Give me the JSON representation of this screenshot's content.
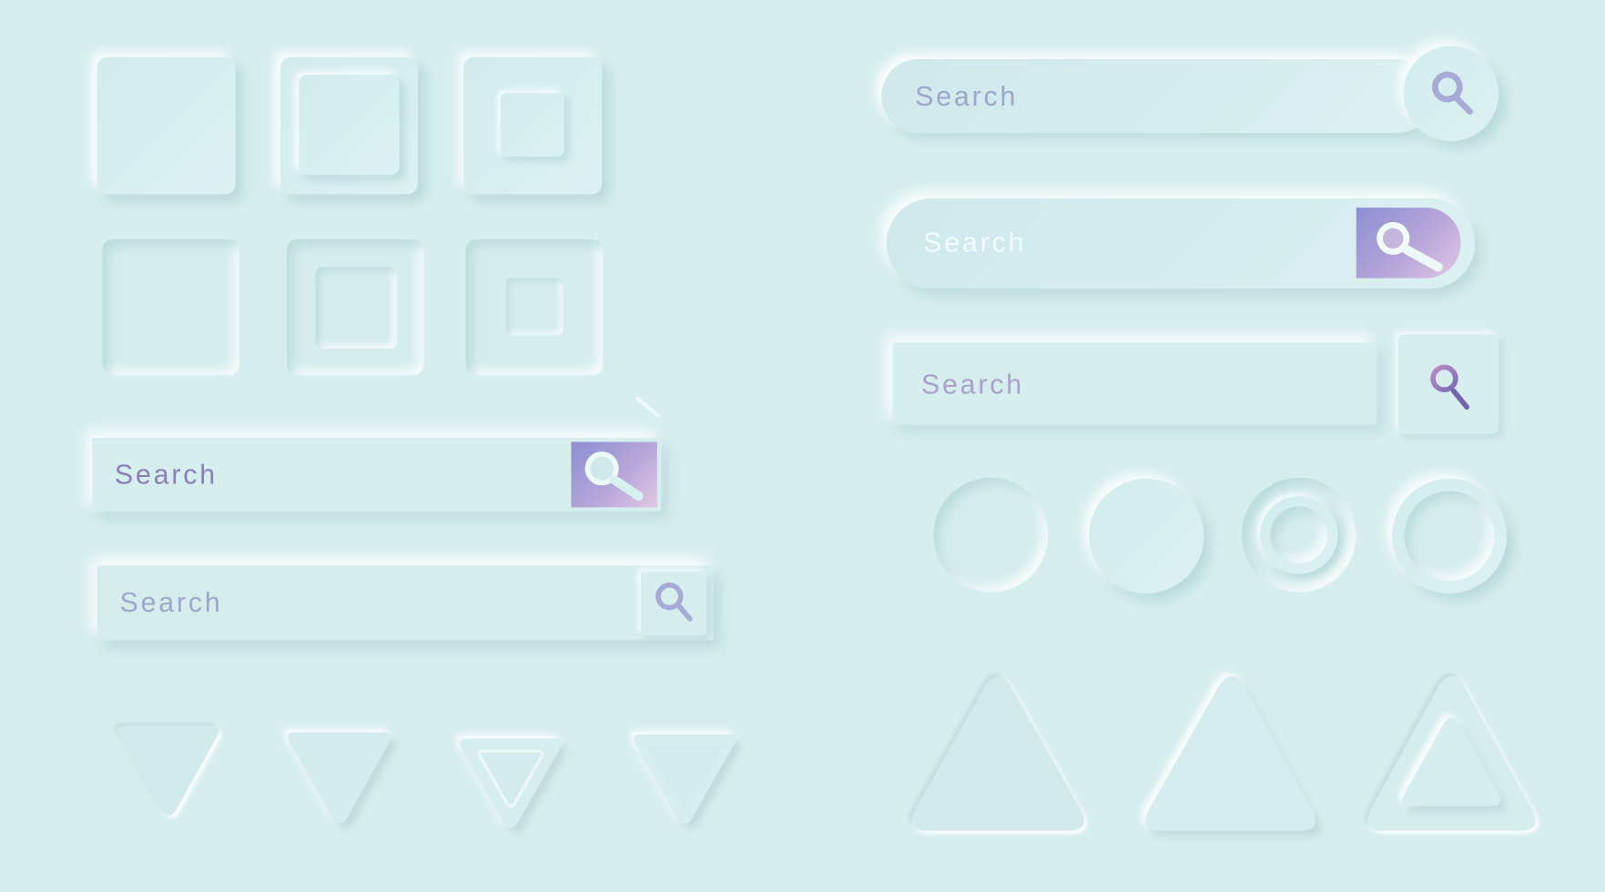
{
  "theme": {
    "background": "#d7eeee",
    "accent_gradient": [
      "#8c8fd2",
      "#e2c7e4"
    ],
    "text_lavender": "#9ea6cb",
    "text_purple": "#8a7fb8",
    "text_white": "#f4fbfb"
  },
  "squares": {
    "raised_row": [
      {
        "name": "raised-square",
        "variant": "flat"
      },
      {
        "name": "raised-square-inner-raised",
        "variant": "nested"
      },
      {
        "name": "raised-square-inner-small",
        "variant": "nested-small"
      }
    ],
    "pressed_row": [
      {
        "name": "pressed-square",
        "variant": "flat"
      },
      {
        "name": "pressed-square-inner",
        "variant": "nested"
      },
      {
        "name": "pressed-square-inner-small",
        "variant": "nested-small"
      }
    ]
  },
  "search_bars": {
    "left_purple": {
      "placeholder": "Search",
      "icon": "search-icon",
      "button_style": "purple-gradient"
    },
    "left_plain": {
      "placeholder": "Search",
      "icon": "search-icon",
      "button_style": "neumorphic"
    },
    "right_round": {
      "placeholder": "Search",
      "icon": "search-icon",
      "button_style": "round-neumorphic"
    },
    "right_pill_purple": {
      "placeholder": "Search",
      "icon": "search-icon",
      "button_style": "purple-gradient-pill"
    },
    "right_split": {
      "placeholder": "Search",
      "icon": "search-icon",
      "button_style": "separate-square"
    }
  },
  "circles": [
    {
      "name": "pressed-circle"
    },
    {
      "name": "raised-circle"
    },
    {
      "name": "ring-circle-pressed"
    },
    {
      "name": "ring-circle-raised"
    }
  ],
  "triangles_down": [
    {
      "name": "triangle-down-pressed"
    },
    {
      "name": "triangle-down-raised"
    },
    {
      "name": "triangle-down-nested"
    },
    {
      "name": "triangle-down-outline"
    }
  ],
  "triangles_up": [
    {
      "name": "triangle-up-pressed"
    },
    {
      "name": "triangle-up-raised"
    },
    {
      "name": "triangle-up-nested"
    }
  ]
}
